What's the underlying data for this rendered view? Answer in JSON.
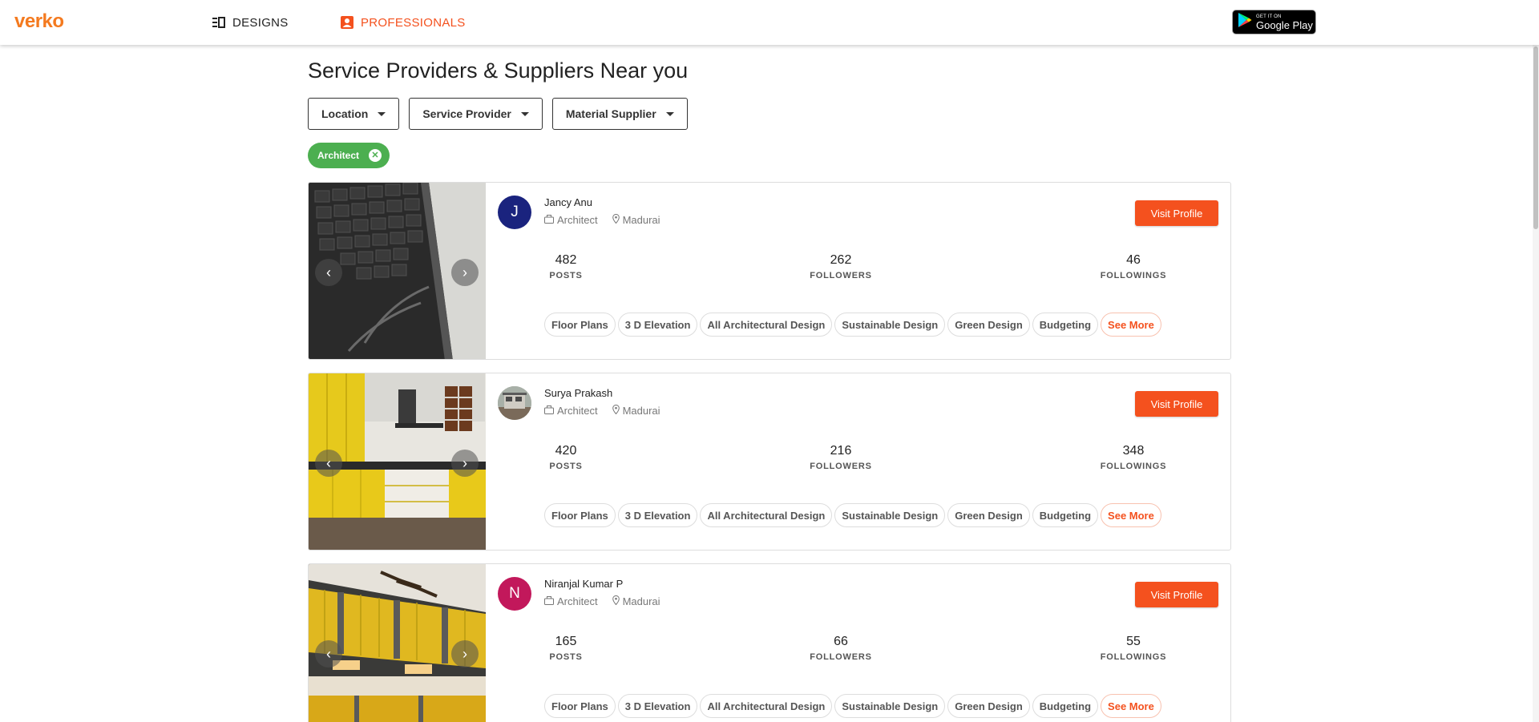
{
  "header": {
    "logo": "verko",
    "nav": [
      {
        "label": "DESIGNS",
        "icon": "designs-icon"
      },
      {
        "label": "PROFESSIONALS",
        "icon": "professionals-icon"
      }
    ],
    "google_play": {
      "small": "GET IT ON",
      "big": "Google Play"
    }
  },
  "page": {
    "title": "Service Providers & Suppliers Near you",
    "filters": [
      "Location",
      "Service Provider",
      "Material Supplier"
    ],
    "active_chip": "Architect"
  },
  "colors": {
    "accent": "#f4511e",
    "logo": "#f47a1f",
    "chip": "#4caf50"
  },
  "cards": [
    {
      "name": "Jancy Anu",
      "initial": "J",
      "avatar_color": "#1a237e",
      "role": "Architect",
      "location": "Madurai",
      "posts": "482",
      "followers": "262",
      "followings": "46",
      "image": "laptop-keyboard-photo"
    },
    {
      "name": "Surya Prakash",
      "initial": "",
      "avatar_color": "#8a8a7a",
      "role": "Architect",
      "location": "Madurai",
      "posts": "420",
      "followers": "216",
      "followings": "348",
      "image": "yellow-kitchen-photo"
    },
    {
      "name": "Niranjal Kumar P",
      "initial": "N",
      "avatar_color": "#c2185b",
      "role": "Architect",
      "location": "Madurai",
      "posts": "165",
      "followers": "66",
      "followings": "55",
      "image": "yellow-cabinet-photo"
    }
  ],
  "labels": {
    "visit": "Visit Profile",
    "posts": "POSTS",
    "followers": "FOLLOWERS",
    "followings": "FOLLOWINGS",
    "see_more": "See More"
  },
  "tags": [
    "Floor Plans",
    "3 D Elevation",
    "All Architectural Design",
    "Sustainable Design",
    "Green Design",
    "Budgeting"
  ]
}
